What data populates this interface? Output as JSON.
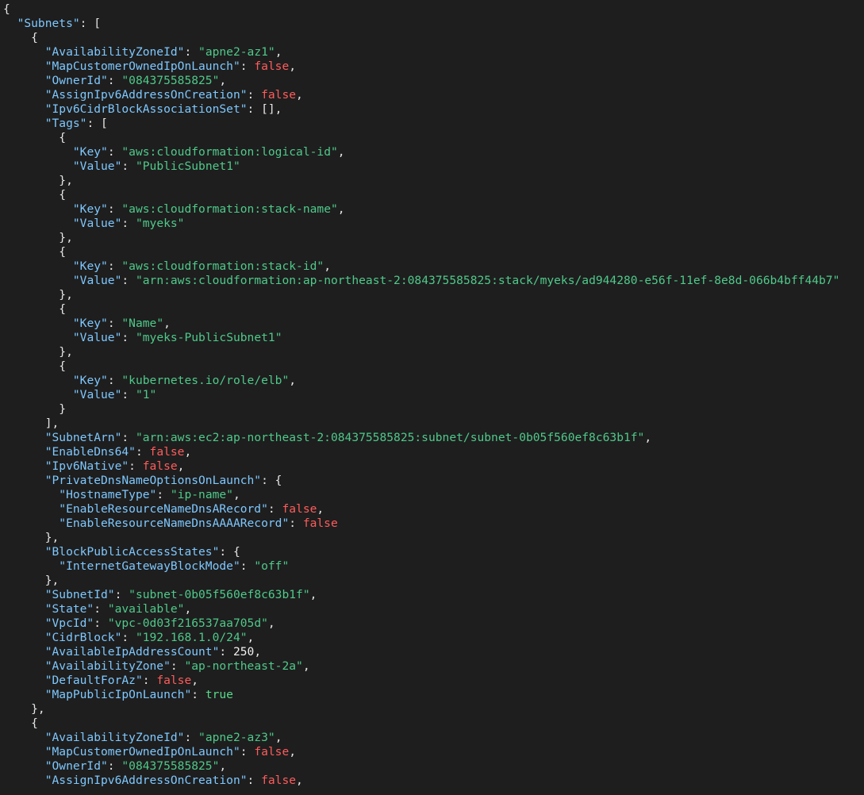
{
  "colors": {
    "background": "#1e1e1e",
    "key": "#7ec8ff",
    "string": "#4fc98a",
    "false": "#ff5c5c",
    "true": "#59d98a",
    "number": "#f0f0f0",
    "punct": "#e6e6e6"
  },
  "lines": [
    [
      {
        "t": "p",
        "v": "{"
      }
    ],
    [
      {
        "t": "p",
        "v": "  "
      },
      {
        "t": "k",
        "v": "\"Subnets\""
      },
      {
        "t": "p",
        "v": ": ["
      }
    ],
    [
      {
        "t": "p",
        "v": "    {"
      }
    ],
    [
      {
        "t": "p",
        "v": "      "
      },
      {
        "t": "k",
        "v": "\"AvailabilityZoneId\""
      },
      {
        "t": "p",
        "v": ": "
      },
      {
        "t": "s",
        "v": "\"apne2-az1\""
      },
      {
        "t": "p",
        "v": ","
      }
    ],
    [
      {
        "t": "p",
        "v": "      "
      },
      {
        "t": "k",
        "v": "\"MapCustomerOwnedIpOnLaunch\""
      },
      {
        "t": "p",
        "v": ": "
      },
      {
        "t": "f",
        "v": "false"
      },
      {
        "t": "p",
        "v": ","
      }
    ],
    [
      {
        "t": "p",
        "v": "      "
      },
      {
        "t": "k",
        "v": "\"OwnerId\""
      },
      {
        "t": "p",
        "v": ": "
      },
      {
        "t": "s",
        "v": "\"084375585825\""
      },
      {
        "t": "p",
        "v": ","
      }
    ],
    [
      {
        "t": "p",
        "v": "      "
      },
      {
        "t": "k",
        "v": "\"AssignIpv6AddressOnCreation\""
      },
      {
        "t": "p",
        "v": ": "
      },
      {
        "t": "f",
        "v": "false"
      },
      {
        "t": "p",
        "v": ","
      }
    ],
    [
      {
        "t": "p",
        "v": "      "
      },
      {
        "t": "k",
        "v": "\"Ipv6CidrBlockAssociationSet\""
      },
      {
        "t": "p",
        "v": ": [],"
      }
    ],
    [
      {
        "t": "p",
        "v": "      "
      },
      {
        "t": "k",
        "v": "\"Tags\""
      },
      {
        "t": "p",
        "v": ": ["
      }
    ],
    [
      {
        "t": "p",
        "v": "        {"
      }
    ],
    [
      {
        "t": "p",
        "v": "          "
      },
      {
        "t": "k",
        "v": "\"Key\""
      },
      {
        "t": "p",
        "v": ": "
      },
      {
        "t": "s",
        "v": "\"aws:cloudformation:logical-id\""
      },
      {
        "t": "p",
        "v": ","
      }
    ],
    [
      {
        "t": "p",
        "v": "          "
      },
      {
        "t": "k",
        "v": "\"Value\""
      },
      {
        "t": "p",
        "v": ": "
      },
      {
        "t": "s",
        "v": "\"PublicSubnet1\""
      }
    ],
    [
      {
        "t": "p",
        "v": "        },"
      }
    ],
    [
      {
        "t": "p",
        "v": "        {"
      }
    ],
    [
      {
        "t": "p",
        "v": "          "
      },
      {
        "t": "k",
        "v": "\"Key\""
      },
      {
        "t": "p",
        "v": ": "
      },
      {
        "t": "s",
        "v": "\"aws:cloudformation:stack-name\""
      },
      {
        "t": "p",
        "v": ","
      }
    ],
    [
      {
        "t": "p",
        "v": "          "
      },
      {
        "t": "k",
        "v": "\"Value\""
      },
      {
        "t": "p",
        "v": ": "
      },
      {
        "t": "s",
        "v": "\"myeks\""
      }
    ],
    [
      {
        "t": "p",
        "v": "        },"
      }
    ],
    [
      {
        "t": "p",
        "v": "        {"
      }
    ],
    [
      {
        "t": "p",
        "v": "          "
      },
      {
        "t": "k",
        "v": "\"Key\""
      },
      {
        "t": "p",
        "v": ": "
      },
      {
        "t": "s",
        "v": "\"aws:cloudformation:stack-id\""
      },
      {
        "t": "p",
        "v": ","
      }
    ],
    [
      {
        "t": "p",
        "v": "          "
      },
      {
        "t": "k",
        "v": "\"Value\""
      },
      {
        "t": "p",
        "v": ": "
      },
      {
        "t": "s",
        "v": "\"arn:aws:cloudformation:ap-northeast-2:084375585825:stack/myeks/ad944280-e56f-11ef-8e8d-066b4bff44b7\""
      }
    ],
    [
      {
        "t": "p",
        "v": "        },"
      }
    ],
    [
      {
        "t": "p",
        "v": "        {"
      }
    ],
    [
      {
        "t": "p",
        "v": "          "
      },
      {
        "t": "k",
        "v": "\"Key\""
      },
      {
        "t": "p",
        "v": ": "
      },
      {
        "t": "s",
        "v": "\"Name\""
      },
      {
        "t": "p",
        "v": ","
      }
    ],
    [
      {
        "t": "p",
        "v": "          "
      },
      {
        "t": "k",
        "v": "\"Value\""
      },
      {
        "t": "p",
        "v": ": "
      },
      {
        "t": "s",
        "v": "\"myeks-PublicSubnet1\""
      }
    ],
    [
      {
        "t": "p",
        "v": "        },"
      }
    ],
    [
      {
        "t": "p",
        "v": "        {"
      }
    ],
    [
      {
        "t": "p",
        "v": "          "
      },
      {
        "t": "k",
        "v": "\"Key\""
      },
      {
        "t": "p",
        "v": ": "
      },
      {
        "t": "s",
        "v": "\"kubernetes.io/role/elb\""
      },
      {
        "t": "p",
        "v": ","
      }
    ],
    [
      {
        "t": "p",
        "v": "          "
      },
      {
        "t": "k",
        "v": "\"Value\""
      },
      {
        "t": "p",
        "v": ": "
      },
      {
        "t": "s",
        "v": "\"1\""
      }
    ],
    [
      {
        "t": "p",
        "v": "        }"
      }
    ],
    [
      {
        "t": "p",
        "v": "      ],"
      }
    ],
    [
      {
        "t": "p",
        "v": "      "
      },
      {
        "t": "k",
        "v": "\"SubnetArn\""
      },
      {
        "t": "p",
        "v": ": "
      },
      {
        "t": "s",
        "v": "\"arn:aws:ec2:ap-northeast-2:084375585825:subnet/subnet-0b05f560ef8c63b1f\""
      },
      {
        "t": "p",
        "v": ","
      }
    ],
    [
      {
        "t": "p",
        "v": "      "
      },
      {
        "t": "k",
        "v": "\"EnableDns64\""
      },
      {
        "t": "p",
        "v": ": "
      },
      {
        "t": "f",
        "v": "false"
      },
      {
        "t": "p",
        "v": ","
      }
    ],
    [
      {
        "t": "p",
        "v": "      "
      },
      {
        "t": "k",
        "v": "\"Ipv6Native\""
      },
      {
        "t": "p",
        "v": ": "
      },
      {
        "t": "f",
        "v": "false"
      },
      {
        "t": "p",
        "v": ","
      }
    ],
    [
      {
        "t": "p",
        "v": "      "
      },
      {
        "t": "k",
        "v": "\"PrivateDnsNameOptionsOnLaunch\""
      },
      {
        "t": "p",
        "v": ": {"
      }
    ],
    [
      {
        "t": "p",
        "v": "        "
      },
      {
        "t": "k",
        "v": "\"HostnameType\""
      },
      {
        "t": "p",
        "v": ": "
      },
      {
        "t": "s",
        "v": "\"ip-name\""
      },
      {
        "t": "p",
        "v": ","
      }
    ],
    [
      {
        "t": "p",
        "v": "        "
      },
      {
        "t": "k",
        "v": "\"EnableResourceNameDnsARecord\""
      },
      {
        "t": "p",
        "v": ": "
      },
      {
        "t": "f",
        "v": "false"
      },
      {
        "t": "p",
        "v": ","
      }
    ],
    [
      {
        "t": "p",
        "v": "        "
      },
      {
        "t": "k",
        "v": "\"EnableResourceNameDnsAAAARecord\""
      },
      {
        "t": "p",
        "v": ": "
      },
      {
        "t": "f",
        "v": "false"
      }
    ],
    [
      {
        "t": "p",
        "v": "      },"
      }
    ],
    [
      {
        "t": "p",
        "v": "      "
      },
      {
        "t": "k",
        "v": "\"BlockPublicAccessStates\""
      },
      {
        "t": "p",
        "v": ": {"
      }
    ],
    [
      {
        "t": "p",
        "v": "        "
      },
      {
        "t": "k",
        "v": "\"InternetGatewayBlockMode\""
      },
      {
        "t": "p",
        "v": ": "
      },
      {
        "t": "s",
        "v": "\"off\""
      }
    ],
    [
      {
        "t": "p",
        "v": "      },"
      }
    ],
    [
      {
        "t": "p",
        "v": "      "
      },
      {
        "t": "k",
        "v": "\"SubnetId\""
      },
      {
        "t": "p",
        "v": ": "
      },
      {
        "t": "s",
        "v": "\"subnet-0b05f560ef8c63b1f\""
      },
      {
        "t": "p",
        "v": ","
      }
    ],
    [
      {
        "t": "p",
        "v": "      "
      },
      {
        "t": "k",
        "v": "\"State\""
      },
      {
        "t": "p",
        "v": ": "
      },
      {
        "t": "s",
        "v": "\"available\""
      },
      {
        "t": "p",
        "v": ","
      }
    ],
    [
      {
        "t": "p",
        "v": "      "
      },
      {
        "t": "k",
        "v": "\"VpcId\""
      },
      {
        "t": "p",
        "v": ": "
      },
      {
        "t": "s",
        "v": "\"vpc-0d03f216537aa705d\""
      },
      {
        "t": "p",
        "v": ","
      }
    ],
    [
      {
        "t": "p",
        "v": "      "
      },
      {
        "t": "k",
        "v": "\"CidrBlock\""
      },
      {
        "t": "p",
        "v": ": "
      },
      {
        "t": "s",
        "v": "\"192.168.1.0/24\""
      },
      {
        "t": "p",
        "v": ","
      }
    ],
    [
      {
        "t": "p",
        "v": "      "
      },
      {
        "t": "k",
        "v": "\"AvailableIpAddressCount\""
      },
      {
        "t": "p",
        "v": ": "
      },
      {
        "t": "n",
        "v": "250"
      },
      {
        "t": "p",
        "v": ","
      }
    ],
    [
      {
        "t": "p",
        "v": "      "
      },
      {
        "t": "k",
        "v": "\"AvailabilityZone\""
      },
      {
        "t": "p",
        "v": ": "
      },
      {
        "t": "s",
        "v": "\"ap-northeast-2a\""
      },
      {
        "t": "p",
        "v": ","
      }
    ],
    [
      {
        "t": "p",
        "v": "      "
      },
      {
        "t": "k",
        "v": "\"DefaultForAz\""
      },
      {
        "t": "p",
        "v": ": "
      },
      {
        "t": "f",
        "v": "false"
      },
      {
        "t": "p",
        "v": ","
      }
    ],
    [
      {
        "t": "p",
        "v": "      "
      },
      {
        "t": "k",
        "v": "\"MapPublicIpOnLaunch\""
      },
      {
        "t": "p",
        "v": ": "
      },
      {
        "t": "T",
        "v": "true"
      }
    ],
    [
      {
        "t": "p",
        "v": "    },"
      }
    ],
    [
      {
        "t": "p",
        "v": "    {"
      }
    ],
    [
      {
        "t": "p",
        "v": "      "
      },
      {
        "t": "k",
        "v": "\"AvailabilityZoneId\""
      },
      {
        "t": "p",
        "v": ": "
      },
      {
        "t": "s",
        "v": "\"apne2-az3\""
      },
      {
        "t": "p",
        "v": ","
      }
    ],
    [
      {
        "t": "p",
        "v": "      "
      },
      {
        "t": "k",
        "v": "\"MapCustomerOwnedIpOnLaunch\""
      },
      {
        "t": "p",
        "v": ": "
      },
      {
        "t": "f",
        "v": "false"
      },
      {
        "t": "p",
        "v": ","
      }
    ],
    [
      {
        "t": "p",
        "v": "      "
      },
      {
        "t": "k",
        "v": "\"OwnerId\""
      },
      {
        "t": "p",
        "v": ": "
      },
      {
        "t": "s",
        "v": "\"084375585825\""
      },
      {
        "t": "p",
        "v": ","
      }
    ],
    [
      {
        "t": "p",
        "v": "      "
      },
      {
        "t": "k",
        "v": "\"AssignIpv6AddressOnCreation\""
      },
      {
        "t": "p",
        "v": ": "
      },
      {
        "t": "f",
        "v": "false"
      },
      {
        "t": "p",
        "v": ","
      }
    ]
  ]
}
